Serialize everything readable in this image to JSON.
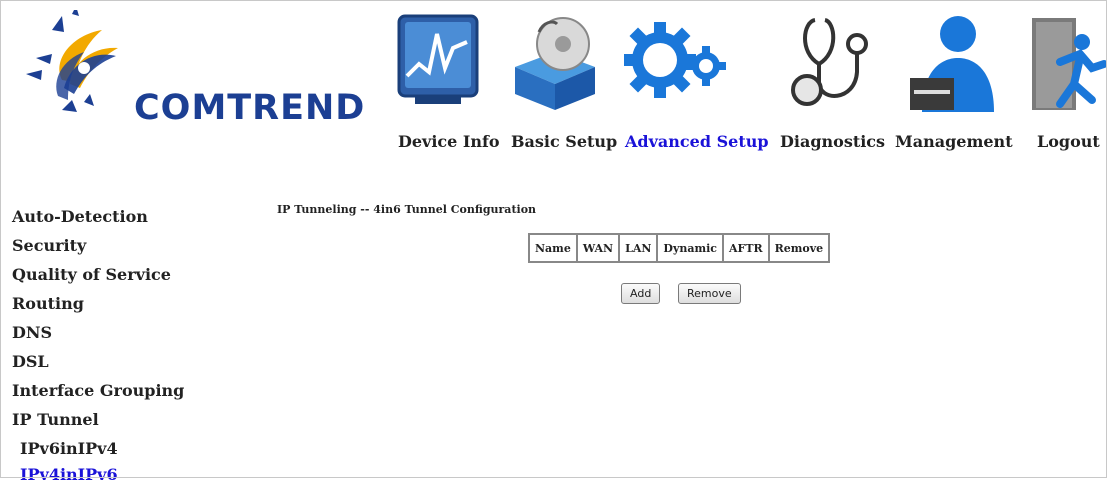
{
  "brand": {
    "name": "COMTREND"
  },
  "nav": {
    "items": [
      {
        "label": "Device Info",
        "icon": "chart-monitor-icon"
      },
      {
        "label": "Basic Setup",
        "icon": "cd-box-icon"
      },
      {
        "label": "Advanced Setup",
        "icon": "gears-icon",
        "active": true
      },
      {
        "label": "Diagnostics",
        "icon": "stethoscope-icon"
      },
      {
        "label": "Management",
        "icon": "user-admin-icon"
      },
      {
        "label": "Logout",
        "icon": "exit-door-icon"
      }
    ]
  },
  "sidebar": {
    "items": [
      {
        "label": "Auto-Detection"
      },
      {
        "label": "Security"
      },
      {
        "label": "Quality of Service"
      },
      {
        "label": "Routing"
      },
      {
        "label": "DNS"
      },
      {
        "label": "DSL"
      },
      {
        "label": "Interface Grouping"
      },
      {
        "label": "IP Tunnel"
      },
      {
        "label": "IPv6inIPv4",
        "sub": true
      },
      {
        "label": "IPv4inIPv6",
        "sub": true,
        "active": true
      }
    ]
  },
  "main": {
    "title": "IP Tunneling -- 4in6 Tunnel Configuration",
    "table": {
      "headers": [
        "Name",
        "WAN",
        "LAN",
        "Dynamic",
        "AFTR",
        "Remove"
      ]
    },
    "buttons": {
      "add": "Add",
      "remove": "Remove"
    }
  },
  "colors": {
    "brand": "#1c3f93",
    "active_link": "#1a12d8",
    "text": "#222222"
  }
}
